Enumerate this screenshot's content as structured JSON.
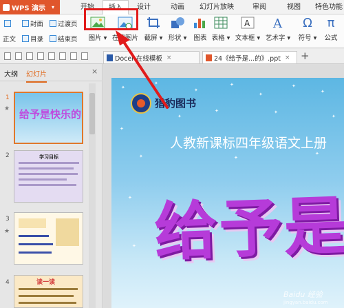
{
  "app": {
    "name": "WPS 演示",
    "caret": "▾"
  },
  "menu": {
    "tabs": [
      {
        "label": "开始"
      },
      {
        "label": "插入",
        "active": true
      },
      {
        "label": "设计"
      },
      {
        "label": "动画"
      },
      {
        "label": "幻灯片放映"
      },
      {
        "label": "审阅"
      },
      {
        "label": "视图"
      },
      {
        "label": "特色功能"
      }
    ]
  },
  "ribbon": {
    "small_left_top": [
      "封面",
      "过渡页"
    ],
    "small_left_bottom": [
      "正文",
      "目录",
      "结束页"
    ],
    "big_buttons": [
      {
        "label": "图片 ▾",
        "icon": "picture-icon"
      },
      {
        "label": "在线图片",
        "icon": "online-picture-icon"
      },
      {
        "label": "截屏 ▾",
        "icon": "screenshot-icon"
      },
      {
        "label": "形状 ▾",
        "icon": "shapes-icon"
      },
      {
        "label": "图表",
        "icon": "chart-icon"
      },
      {
        "label": "表格 ▾",
        "icon": "table-icon"
      },
      {
        "label": "文本框 ▾",
        "icon": "textbox-icon"
      },
      {
        "label": "艺术字 ▾",
        "icon": "wordart-icon"
      },
      {
        "label": "符号 ▾",
        "icon": "omega-icon",
        "glyph": "Ω"
      },
      {
        "label": "公式",
        "icon": "pi-icon",
        "glyph": "π"
      }
    ],
    "highlight_color": "#e11b1b"
  },
  "doc_tabs": [
    {
      "label": "Docer-在线模板",
      "close": "×"
    },
    {
      "label": "24《给予是...的》.ppt",
      "close": "×"
    }
  ],
  "panel": {
    "tabs": [
      "大纲",
      "幻灯片"
    ],
    "active_tab": "幻灯片",
    "close_glyph": "×",
    "slides": [
      {
        "num": "1",
        "starred": true,
        "title": "给予是快乐的"
      },
      {
        "num": "2",
        "starred": false,
        "title": "学习目标"
      },
      {
        "num": "3",
        "starred": true,
        "title": ""
      },
      {
        "num": "4",
        "starred": false,
        "title": "读一读"
      }
    ]
  },
  "slide": {
    "brand": "猎豹图书",
    "subtitle": "人教新课标四年级语文上册",
    "title": "给予是快乐的",
    "watermark_line1": "Baidu 经验",
    "watermark_line2": "jingyan.baidu.com"
  },
  "colors": {
    "accent": "#e0562c",
    "active_tab_orange": "#e06a1e",
    "title_purple": "#b63bd9"
  }
}
